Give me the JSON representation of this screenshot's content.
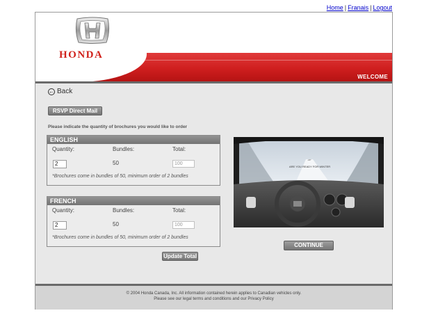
{
  "top_links": {
    "home": "Home",
    "french": "Franais",
    "logout": "Logout",
    "sep": "|"
  },
  "header": {
    "brand": "HONDA",
    "welcome": "WELCOME"
  },
  "back_label": "Back",
  "rsvp_button": "RSVP Direct Mail",
  "instruction": "Please indicate the quantity of brochures you would like to order",
  "sections": {
    "english": {
      "title": "ENGLISH",
      "quantity_label": "Quantity:",
      "bundles_label": "Bundles:",
      "total_label": "Total:",
      "quantity_value": "2",
      "bundles_value": "50",
      "total_value": "100",
      "note": "*Brochures come in bundles of 50, minimum order of 2 bundles"
    },
    "french": {
      "title": "FRENCH",
      "quantity_label": "Quantity:",
      "bundles_label": "Bundles:",
      "total_label": "Total:",
      "quantity_value": "2",
      "bundles_value": "50",
      "total_value": "100",
      "note": "*Brochures come in bundles of 50, minimum order of 2 bundles"
    }
  },
  "update_button": "Update Total",
  "continue_button": "CONTINUE",
  "photo_caption": "ARE YOU READY FOR WINTER",
  "footer": {
    "line1": "© 2004 Honda Canada, Inc.  All information contained herein applies to Canadian vehicles only.",
    "line2": "Please see our legal terms and conditions and our Privacy Policy"
  },
  "colors": {
    "brand_red": "#d0201a",
    "link_blue": "#0000cc",
    "button_gray": "#8a8a8a"
  }
}
